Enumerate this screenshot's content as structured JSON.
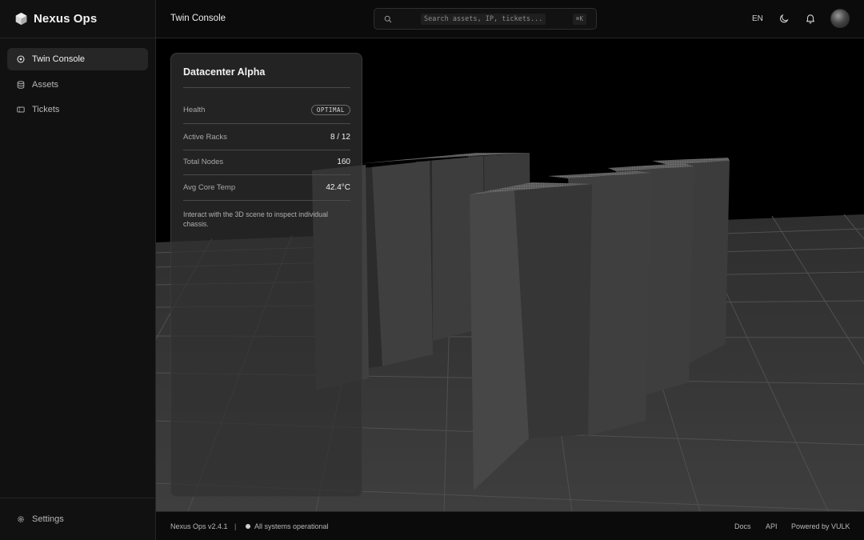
{
  "brand": {
    "name": "Nexus Ops",
    "icon": "hexagon-logo-icon"
  },
  "sidebar": {
    "items": [
      {
        "label": "Twin Console",
        "icon": "target-icon",
        "active": true
      },
      {
        "label": "Assets",
        "icon": "database-icon",
        "active": false
      },
      {
        "label": "Tickets",
        "icon": "ticket-icon",
        "active": false
      }
    ],
    "settings": {
      "label": "Settings",
      "icon": "gear-icon"
    }
  },
  "header": {
    "title": "Twin Console",
    "search": {
      "placeholder": "Search assets, IP, tickets...",
      "shortcut": "⌘K"
    },
    "language": "EN",
    "icons": [
      "moon-icon",
      "bell-icon",
      "avatar"
    ]
  },
  "panel": {
    "title": "Datacenter Alpha",
    "rows": [
      {
        "label": "Health",
        "value": "OPTIMAL",
        "type": "badge"
      },
      {
        "label": "Active Racks",
        "value": "8 / 12"
      },
      {
        "label": "Total Nodes",
        "value": "160"
      },
      {
        "label": "Avg Core Temp",
        "value": "42.4°C"
      }
    ],
    "note": "Interact with the 3D scene to inspect individual chassis."
  },
  "footer": {
    "version": "Nexus Ops v2.4.1",
    "separator": "|",
    "status": "All systems operational",
    "links": {
      "docs": "Docs",
      "api": "API",
      "powered": "Powered by VULK"
    }
  },
  "colors": {
    "background": "#0a0a0a",
    "sidebar": "#111111",
    "active_item": "#262626",
    "border": "#262626"
  }
}
